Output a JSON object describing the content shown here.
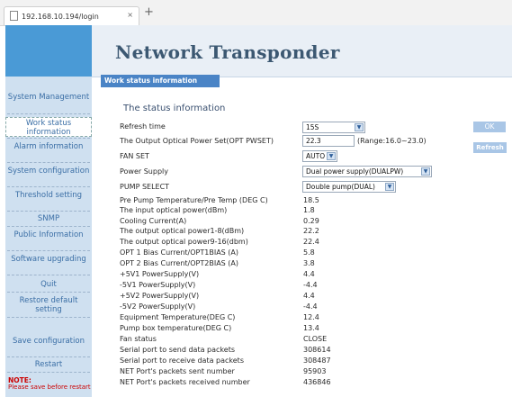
{
  "browser": {
    "tab_title": "192.168.10.194/login",
    "tab_close": "×",
    "new_tab": "+"
  },
  "header": {
    "title": "Network Transponder",
    "section": "Work status information"
  },
  "sidebar": {
    "items": [
      {
        "label": "System Management"
      },
      {
        "label": "Work status information"
      },
      {
        "label": "Alarm information"
      },
      {
        "label": "System configuration"
      },
      {
        "label": "Threshold setting"
      },
      {
        "label": "SNMP"
      },
      {
        "label": "Public Information"
      },
      {
        "label": "Software upgrading"
      },
      {
        "label": "Quit"
      },
      {
        "label": "Restore default setting"
      },
      {
        "label": "Save configuration"
      },
      {
        "label": "Restart"
      }
    ],
    "note_title": "NOTE:",
    "note_text": "Please save before restart"
  },
  "content": {
    "title": "The status information",
    "refresh_time_label": "Refresh time",
    "refresh_time_value": "15S",
    "opt_pwset_label": "The Output Optical Power Set(OPT PWSET)",
    "opt_pwset_value": "22.3",
    "opt_pwset_range": "(Range:16.0~23.0)",
    "fan_set_label": "FAN SET",
    "fan_set_value": "AUTO",
    "power_supply_label": "Power Supply",
    "power_supply_value": "Dual power supply(DUALPW)",
    "pump_select_label": "PUMP SELECT",
    "pump_select_value": "Double pump(DUAL)",
    "ok_button": "OK",
    "refresh_button": "Refresh",
    "rows": [
      {
        "label": "Pre Pump Temperature/Pre Temp (DEG C)",
        "value": "18.5"
      },
      {
        "label": "The input optical power(dBm)",
        "value": "1.8"
      },
      {
        "label": "Cooling Current(A)",
        "value": "0.29"
      },
      {
        "label": "The output optical power1-8(dBm)",
        "value": "22.2"
      },
      {
        "label": "The output optical power9-16(dbm)",
        "value": "22.4"
      },
      {
        "label": "OPT 1 Bias Current/OPT1BIAS (A)",
        "value": "5.8"
      },
      {
        "label": "OPT 2 Bias Current/OPT2BIAS (A)",
        "value": "3.8"
      },
      {
        "label": "+5V1 PowerSupply(V)",
        "value": "4.4"
      },
      {
        "label": "-5V1 PowerSupply(V)",
        "value": "-4.4"
      },
      {
        "label": "+5V2 PowerSupply(V)",
        "value": "4.4"
      },
      {
        "label": "-5V2 PowerSupply(V)",
        "value": "-4.4"
      },
      {
        "label": "Equipment Temperature(DEG C)",
        "value": "12.4"
      },
      {
        "label": "Pump box temperature(DEG C)",
        "value": "13.4"
      },
      {
        "label": "Fan status",
        "value": "CLOSE"
      },
      {
        "label": "Serial port to send data packets",
        "value": "308614"
      },
      {
        "label": "Serial port to receive data packets",
        "value": "308487"
      },
      {
        "label": "NET Port's packets sent number",
        "value": "95903"
      },
      {
        "label": "NET Port's packets received number",
        "value": "436846"
      }
    ]
  }
}
